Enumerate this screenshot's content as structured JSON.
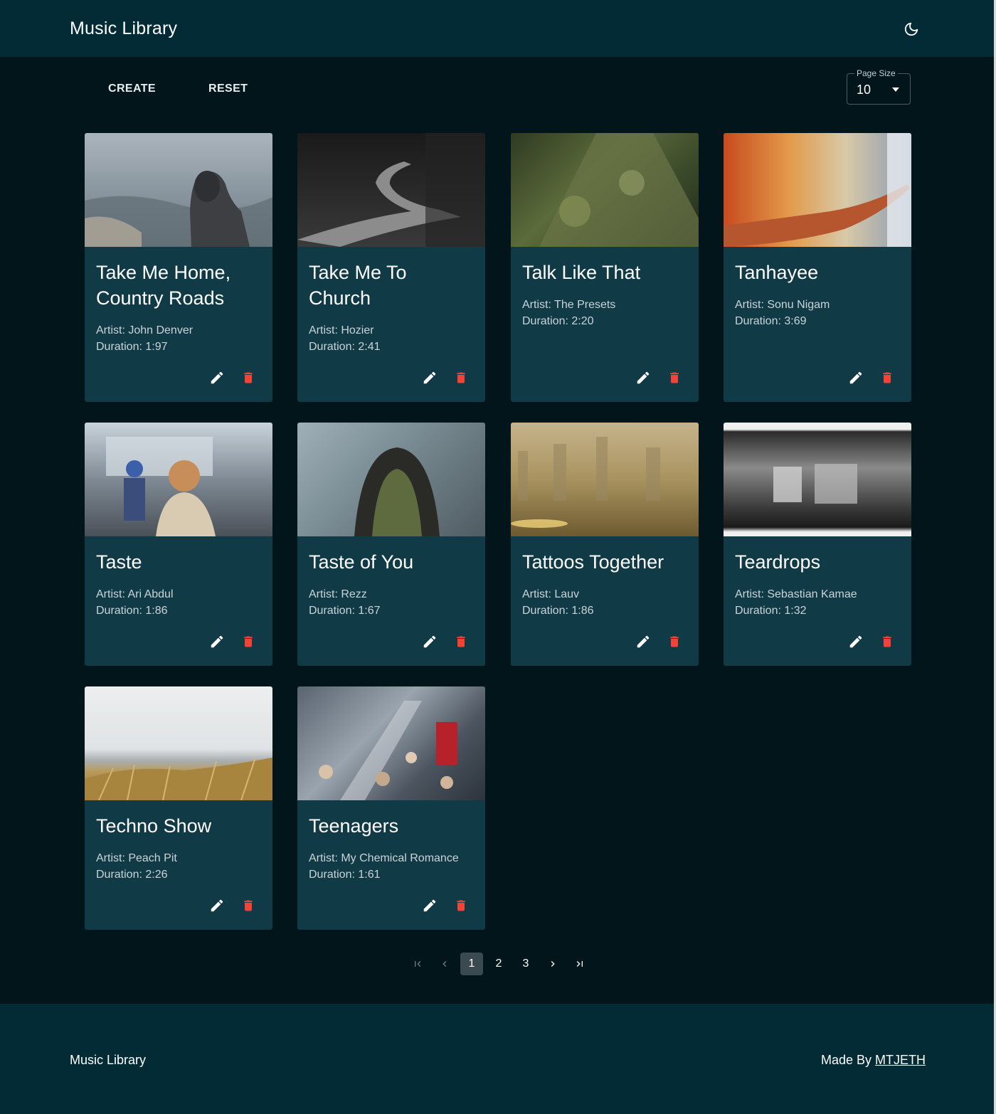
{
  "header": {
    "title": "Music Library",
    "theme_toggle_icon": "moon-icon"
  },
  "toolbar": {
    "create_label": "CREATE",
    "reset_label": "RESET",
    "page_size_label": "Page Size",
    "page_size_value": "10"
  },
  "songs": [
    {
      "title": "Take Me Home, Country Roads",
      "artist": "Artist: John Denver",
      "duration": "Duration: 1:97"
    },
    {
      "title": "Take Me To Church",
      "artist": "Artist: Hozier",
      "duration": "Duration: 2:41"
    },
    {
      "title": "Talk Like That",
      "artist": "Artist: The Presets",
      "duration": "Duration: 2:20"
    },
    {
      "title": "Tanhayee",
      "artist": "Artist: Sonu Nigam",
      "duration": "Duration: 3:69"
    },
    {
      "title": "Taste",
      "artist": "Artist: Ari Abdul",
      "duration": "Duration: 1:86"
    },
    {
      "title": "Taste of You",
      "artist": "Artist: Rezz",
      "duration": "Duration: 1:67"
    },
    {
      "title": "Tattoos Together",
      "artist": "Artist: Lauv",
      "duration": "Duration: 1:86"
    },
    {
      "title": "Teardrops",
      "artist": "Artist: Sebastian Kamae",
      "duration": "Duration: 1:32"
    },
    {
      "title": "Techno Show",
      "artist": "Artist: Peach Pit",
      "duration": "Duration: 2:26"
    },
    {
      "title": "Teenagers",
      "artist": "Artist: My Chemical Romance",
      "duration": "Duration: 1:61"
    }
  ],
  "pagination": {
    "pages": [
      "1",
      "2",
      "3"
    ],
    "current": "1",
    "icons": [
      "first-page-icon",
      "previous-page-icon",
      "next-page-icon",
      "last-page-icon"
    ]
  },
  "footer": {
    "title": "Music Library",
    "credit_prefix": "Made By ",
    "credit_link": "MTJETH"
  },
  "colors": {
    "appbar": "#022b36",
    "background": "#02151b",
    "card": "#113a47",
    "delete": "#f44336",
    "edit": "#ffffff"
  }
}
